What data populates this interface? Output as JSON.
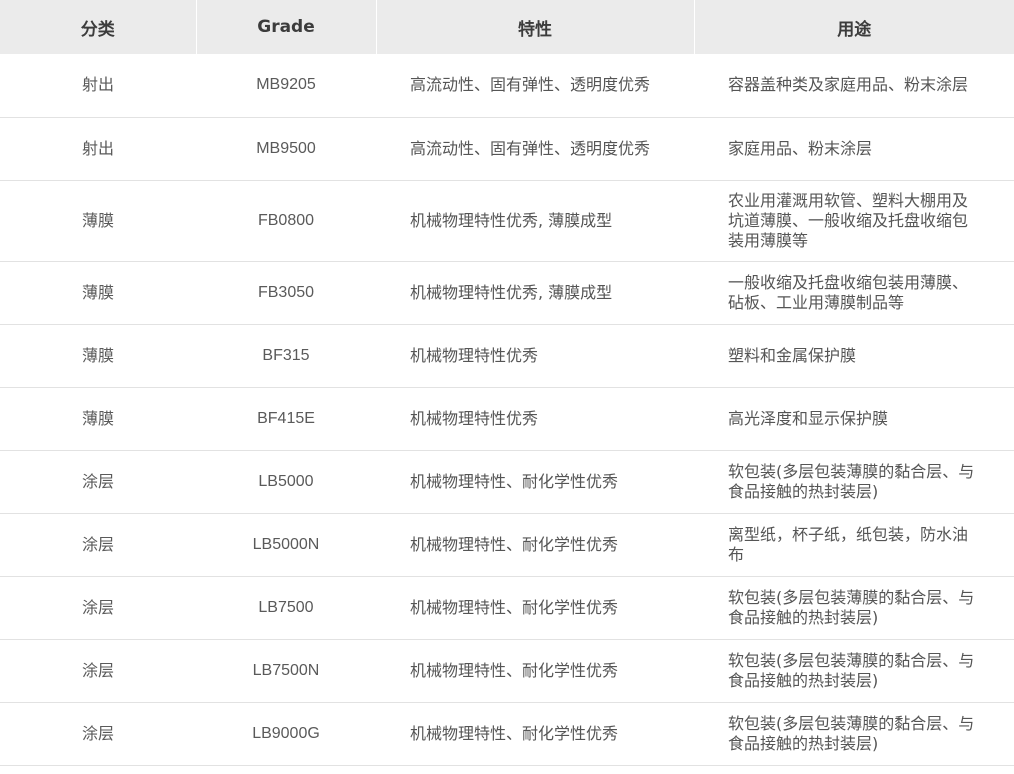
{
  "headers": [
    "分类",
    "Grade",
    "特性",
    "用途"
  ],
  "rows": [
    {
      "category": "射出",
      "grade": "MB9205",
      "property": "高流动性、固有弹性、透明度优秀",
      "use": "容器盖种类及家庭用品、粉末涂层"
    },
    {
      "category": "射出",
      "grade": "MB9500",
      "property": "高流动性、固有弹性、透明度优秀",
      "use": "家庭用品、粉末涂层"
    },
    {
      "category": "薄膜",
      "grade": "FB0800",
      "property": "机械物理特性优秀, 薄膜成型",
      "use": "农业用灌溉用软管、塑料大棚用及坑道薄膜、一般收缩及托盘收缩包装用薄膜等"
    },
    {
      "category": "薄膜",
      "grade": "FB3050",
      "property": "机械物理特性优秀, 薄膜成型",
      "use": "一般收缩及托盘收缩包装用薄膜、砧板、工业用薄膜制品等"
    },
    {
      "category": "薄膜",
      "grade": "BF315",
      "property": "机械物理特性优秀",
      "use": "塑料和金属保护膜"
    },
    {
      "category": "薄膜",
      "grade": "BF415E",
      "property": "机械物理特性优秀",
      "use": "高光泽度和显示保护膜"
    },
    {
      "category": "涂层",
      "grade": "LB5000",
      "property": "机械物理特性、耐化学性优秀",
      "use": "软包装(多层包装薄膜的黏合层、与食品接触的热封装层)"
    },
    {
      "category": "涂层",
      "grade": "LB5000N",
      "property": "机械物理特性、耐化学性优秀",
      "use": "离型纸，杯子纸，纸包装，防水油布"
    },
    {
      "category": "涂层",
      "grade": "LB7500",
      "property": "机械物理特性、耐化学性优秀",
      "use": "软包装(多层包装薄膜的黏合层、与食品接触的热封装层)"
    },
    {
      "category": "涂层",
      "grade": "LB7500N",
      "property": "机械物理特性、耐化学性优秀",
      "use": "软包装(多层包装薄膜的黏合层、与食品接触的热封装层)"
    },
    {
      "category": "涂层",
      "grade": "LB9000G",
      "property": "机械物理特性、耐化学性优秀",
      "use": "软包装(多层包装薄膜的黏合层、与食品接触的热封装层)"
    }
  ]
}
